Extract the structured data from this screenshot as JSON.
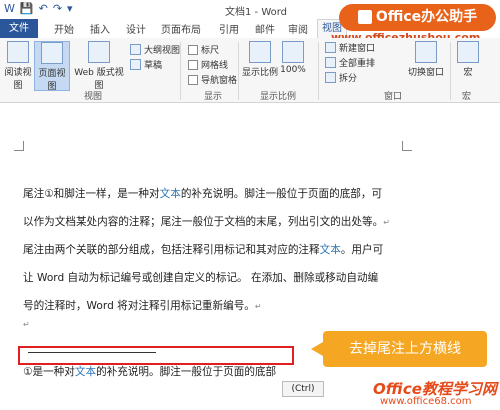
{
  "app": {
    "doc_title": "文档1 - Word"
  },
  "tabs": [
    "文件",
    "开始",
    "插入",
    "设计",
    "页面布局",
    "引用",
    "邮件",
    "审阅",
    "视图"
  ],
  "ribbon": {
    "view_group": {
      "buttons": [
        "阅读视图",
        "页面视图",
        "Web 版式视图"
      ],
      "small": [
        "大纲视图",
        "草稿"
      ],
      "label": "视图"
    },
    "show_group": {
      "options": [
        "标尺",
        "网格线",
        "导航窗格"
      ],
      "label": "显示"
    },
    "zoom_group": {
      "buttons": [
        "显示比例",
        "100%"
      ],
      "label": "显示比例"
    },
    "window_group": {
      "items": [
        "新建窗口",
        "全部重排",
        "拆分"
      ],
      "switch": "切换窗口",
      "label": "窗口"
    },
    "macro_group": {
      "button": "宏",
      "label": "宏"
    }
  },
  "watermark": {
    "brand": "Office办公助手",
    "url": "www.officezhushou.com",
    "site": "Office教程学习网",
    "site_url": "www.office68.com"
  },
  "document": {
    "lines": [
      {
        "a": "尾注①和脚注一样，是一种对",
        "b": "文本",
        "c": "的补充说明。脚注一般位于页面的底部，可"
      },
      {
        "a": "以作为文档某处内容的注释；尾注一般位于文档的末尾，列出引文的出处等。",
        "b": "",
        "c": ""
      },
      {
        "a": "尾注由两个关联的部分组成，包括注释引用标记和其对应的注释",
        "b": "文本",
        "c": "。用户可"
      },
      {
        "a": "让 Word 自动为标记编号或创建自定义的标记。 在添加、删除或移动自动编",
        "b": "",
        "c": ""
      },
      {
        "a": "号的注释时，Word 将对注释引用标记重新编号。",
        "b": "",
        "c": ""
      }
    ],
    "endnote": {
      "a": "①是一种对",
      "b": "文本",
      "c": "的补充说明。脚注一般位于页面的底部"
    },
    "paragraph_mark": "↵",
    "paste_options": "(Ctrl)"
  },
  "callout": "去掉尾注上方横线",
  "colors": {
    "accent": "#2b579a",
    "callout": "#f5a623",
    "highlight": "#e02020"
  }
}
